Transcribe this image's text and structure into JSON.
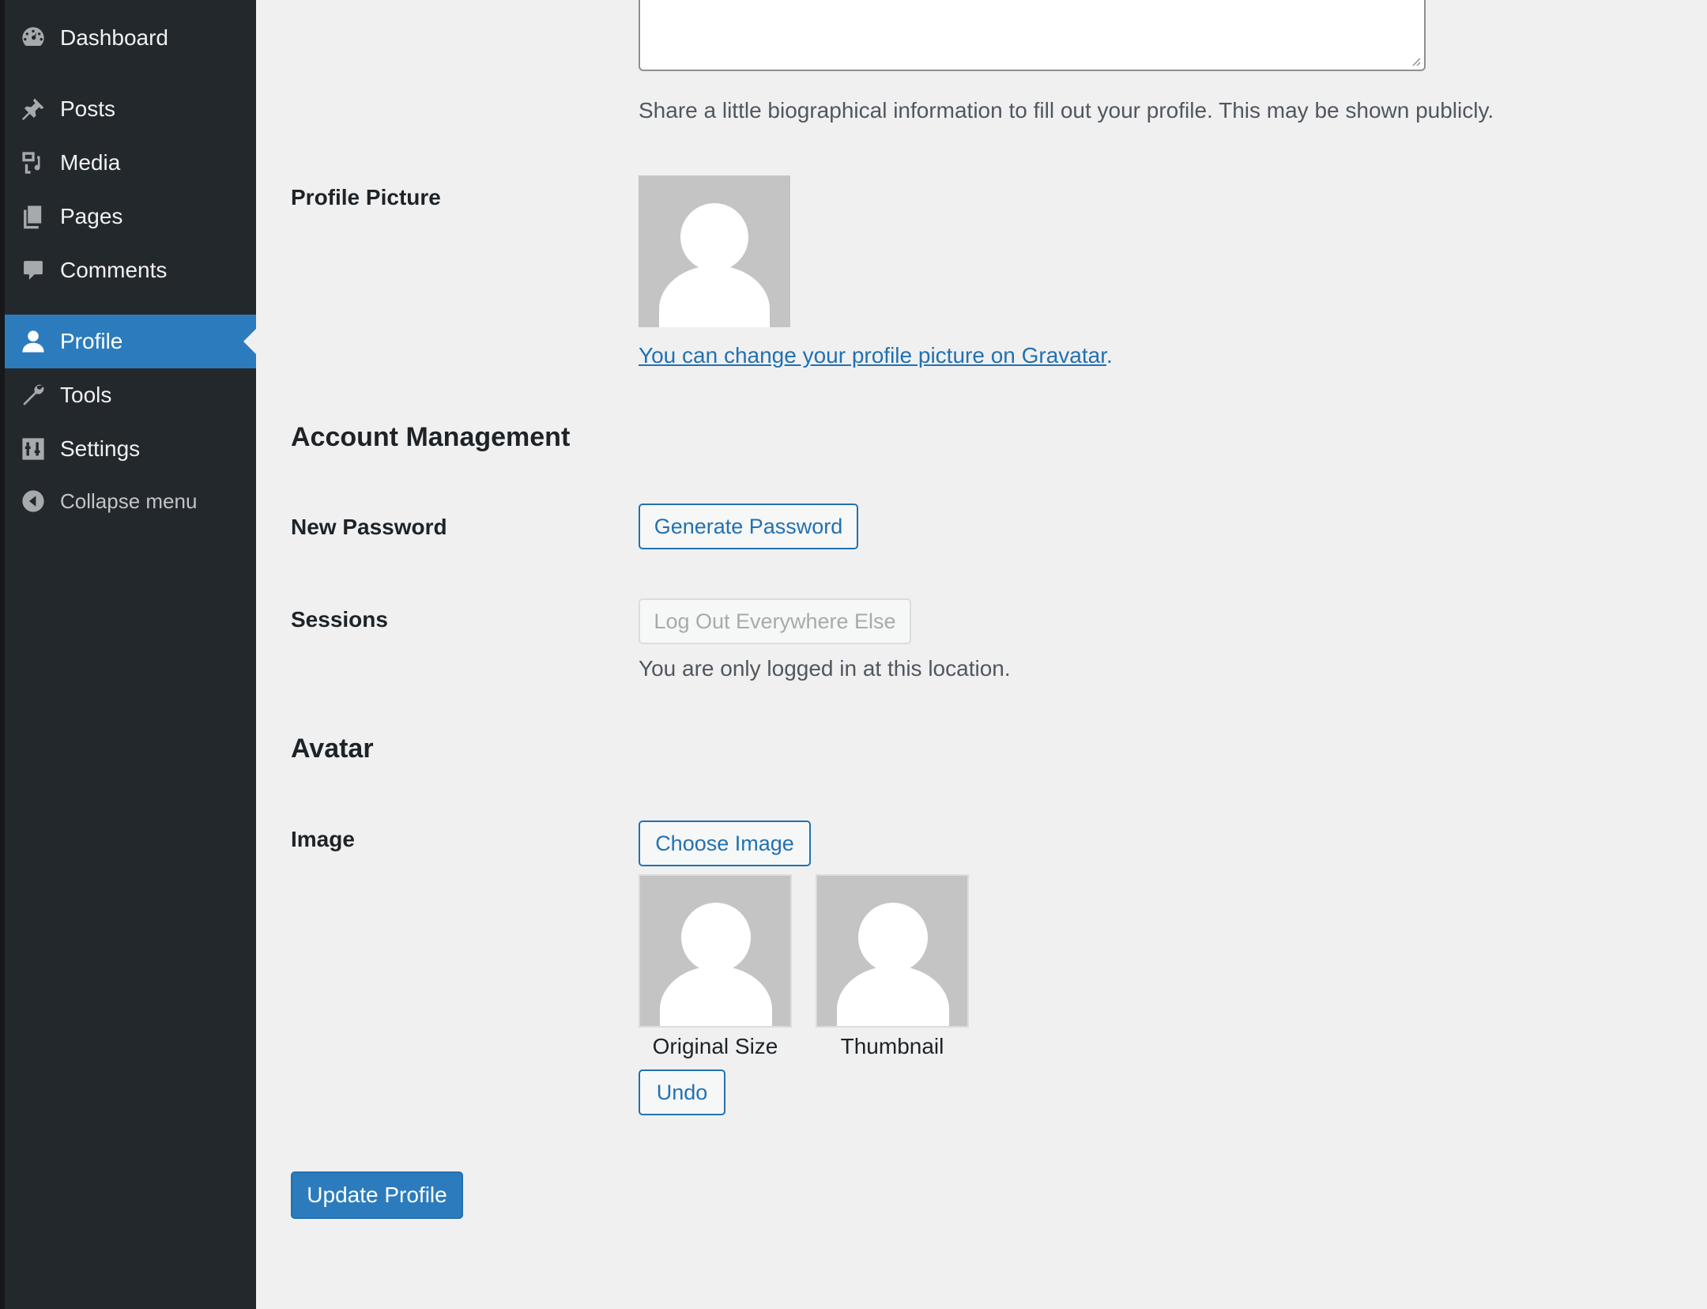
{
  "sidebar": {
    "items": [
      {
        "label": "Dashboard",
        "icon": "dashboard-icon"
      },
      {
        "label": "Posts",
        "icon": "pushpin-icon"
      },
      {
        "label": "Media",
        "icon": "media-icon"
      },
      {
        "label": "Pages",
        "icon": "pages-icon"
      },
      {
        "label": "Comments",
        "icon": "comment-icon"
      },
      {
        "label": "Profile",
        "icon": "user-icon",
        "current": true
      },
      {
        "label": "Tools",
        "icon": "wrench-icon"
      },
      {
        "label": "Settings",
        "icon": "settings-icon"
      }
    ],
    "collapse_label": "Collapse menu"
  },
  "bio": {
    "description": "Share a little biographical information to fill out your profile. This may be shown publicly."
  },
  "profile_picture": {
    "label": "Profile Picture",
    "link_text": "You can change your profile picture on Gravatar",
    "link_suffix": "."
  },
  "account_management": {
    "heading": "Account Management",
    "new_password_label": "New Password",
    "generate_password_button": "Generate Password",
    "sessions_label": "Sessions",
    "logout_button": "Log Out Everywhere Else",
    "sessions_note": "You are only logged in at this location."
  },
  "avatar": {
    "heading": "Avatar",
    "image_label": "Image",
    "choose_button": "Choose Image",
    "original_caption": "Original Size",
    "thumbnail_caption": "Thumbnail",
    "undo_button": "Undo"
  },
  "submit": {
    "update_button": "Update Profile"
  },
  "colors": {
    "sidebar_bg": "#23282d",
    "accent": "#2271b1",
    "current_item_bg": "#2c7cbd",
    "page_bg": "#f0f0f1"
  }
}
